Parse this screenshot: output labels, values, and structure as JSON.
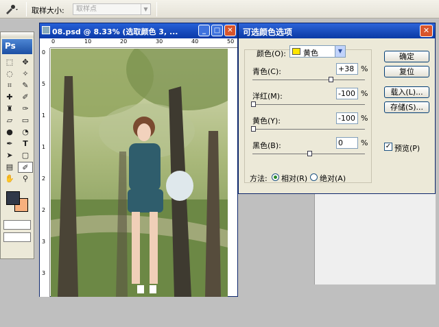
{
  "options_bar": {
    "sample_size_label": "取样大小:",
    "sample_size_value": "取样点"
  },
  "toolbox": {
    "logo": "Ps",
    "tools": [
      "marquee-icon",
      "move-icon",
      "lasso-icon",
      "magic-wand-icon",
      "crop-icon",
      "slice-icon",
      "healing-icon",
      "brush-icon",
      "stamp-icon",
      "history-brush-icon",
      "eraser-icon",
      "gradient-icon",
      "blur-icon",
      "dodge-icon",
      "pen-icon",
      "type-icon",
      "path-select-icon",
      "shape-icon",
      "notes-icon",
      "eyedropper-icon",
      "hand-icon",
      "zoom-icon"
    ],
    "foreground_color": "#303848",
    "background_color": "#f7b07e"
  },
  "document": {
    "title": "08.psd @ 8.33% (选取颜色 3, ...",
    "ruler_h": [
      "0",
      "10",
      "20",
      "30",
      "40",
      "50"
    ],
    "ruler_v": [
      "0",
      "5",
      "1",
      "1",
      "2",
      "2",
      "3",
      "3"
    ]
  },
  "dialog": {
    "title": "可选颜色选项",
    "color_label": "颜色(O):",
    "color_value": "黄色",
    "cyan_label": "青色(C):",
    "cyan_value": "+38",
    "magenta_label": "洋红(M):",
    "magenta_value": "-100",
    "yellow_label": "黄色(Y):",
    "yellow_value": "-100",
    "black_label": "黑色(B):",
    "black_value": "0",
    "percent": "%",
    "ok": "确定",
    "reset": "复位",
    "load": "载入(L)...",
    "save": "存储(S)...",
    "preview": "预览(P)",
    "method_label": "方法:",
    "relative": "相对(R)",
    "absolute": "绝对(A)"
  }
}
